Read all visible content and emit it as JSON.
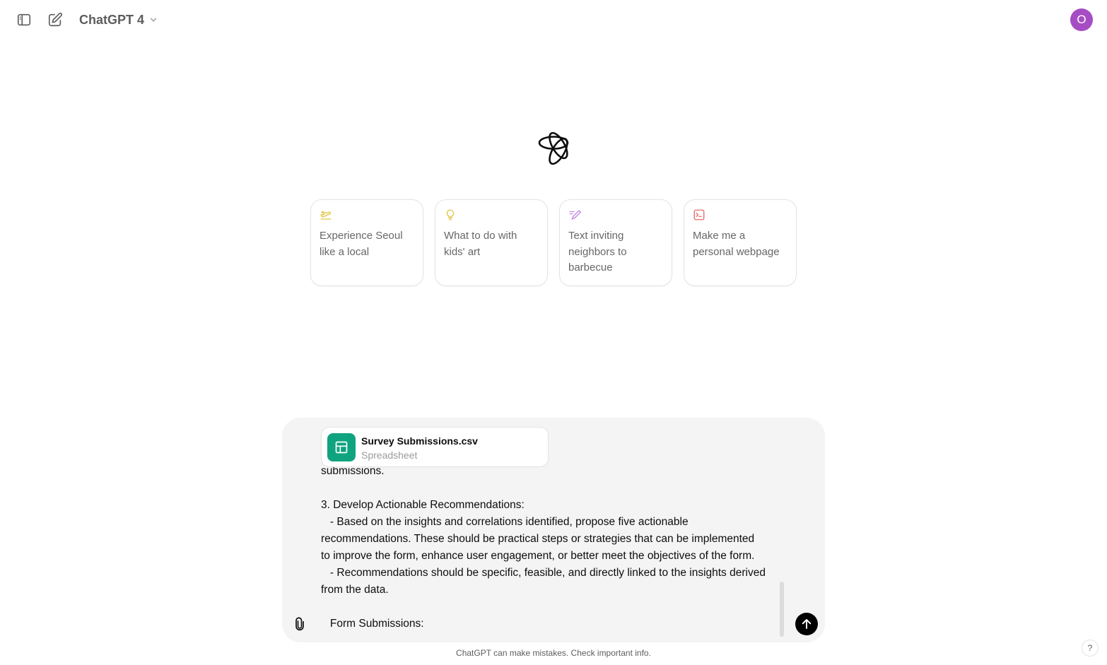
{
  "header": {
    "model_name": "ChatGPT 4",
    "avatar_initial": "O",
    "avatar_color": "#a64dc4"
  },
  "suggestions": [
    {
      "label": "Experience Seoul like a local",
      "icon": "plane-icon",
      "icon_color": "#e2c541"
    },
    {
      "label": "What to do with kids' art",
      "icon": "lightbulb-icon",
      "icon_color": "#e2c541"
    },
    {
      "label": "Text inviting neighbors to barbecue",
      "icon": "pen-icon",
      "icon_color": "#c285e2"
    },
    {
      "label": "Make me a personal webpage",
      "icon": "terminal-icon",
      "icon_color": "#e86969"
    }
  ],
  "composer": {
    "attachment": {
      "name": "Survey Submissions.csv",
      "type": "Spreadsheet",
      "color": "#10a37f"
    },
    "text_lines": [
      "submissions.",
      "",
      "3. Develop Actionable Recommendations:",
      "   - Based on the insights and correlations identified, propose five actionable",
      "recommendations. These should be practical steps or strategies that can be implemented",
      "to improve the form, enhance user engagement, or better meet the objectives of the form.",
      "   - Recommendations should be specific, feasible, and directly linked to the insights derived",
      "from the data.",
      "",
      "   Form Submissions:"
    ]
  },
  "footer": {
    "disclaimer": "ChatGPT can make mistakes. Check important info.",
    "help_label": "?"
  }
}
